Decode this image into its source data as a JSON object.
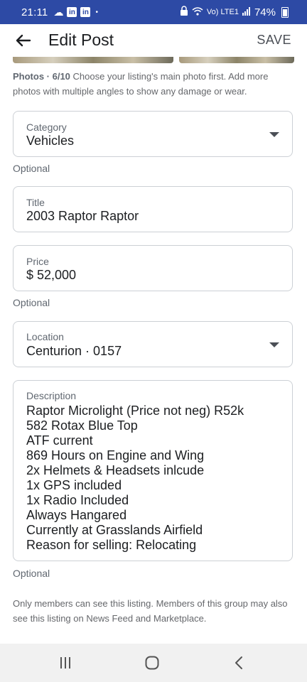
{
  "status_bar": {
    "time": "21:11",
    "dot": "•",
    "linkedin_label": "in",
    "network_label": "Vo) LTE1",
    "battery": "74%"
  },
  "app_bar": {
    "title": "Edit Post",
    "save_label": "SAVE"
  },
  "photos": {
    "label": "Photos · 6/10",
    "hint": "Choose your listing's main photo first. Add more photos with multiple angles to show any damage or wear."
  },
  "category": {
    "label": "Category",
    "value": "Vehicles",
    "helper": "Optional"
  },
  "title_field": {
    "label": "Title",
    "value": "2003 Raptor Raptor"
  },
  "price": {
    "label": "Price",
    "value": "$ 52,000",
    "helper": "Optional"
  },
  "location": {
    "label": "Location",
    "value": "Centurion · 0157"
  },
  "description": {
    "label": "Description",
    "lines": [
      "Raptor Microlight (Price not neg) R52k",
      "582 Rotax Blue Top",
      "ATF current",
      "869 Hours on Engine and Wing",
      "2x Helmets & Headsets inlcude",
      "1x GPS included",
      "1x Radio Included",
      "Always Hangared",
      "Currently at Grasslands Airfield",
      "Reason for selling: Relocating"
    ],
    "helper": "Optional"
  },
  "visibility_note": "Only members can see this listing. Members of this group may also see this listing on News Feed and Marketplace.",
  "colors": {
    "status_bar": "#2d4aa5",
    "border": "#ccd0d5",
    "secondary_text": "#606770"
  },
  "icons": {
    "back": "arrow-left-icon",
    "dropdown": "caret-down-icon",
    "nav_recents": "recents-icon",
    "nav_home": "home-icon",
    "nav_back": "chevron-left-icon"
  }
}
